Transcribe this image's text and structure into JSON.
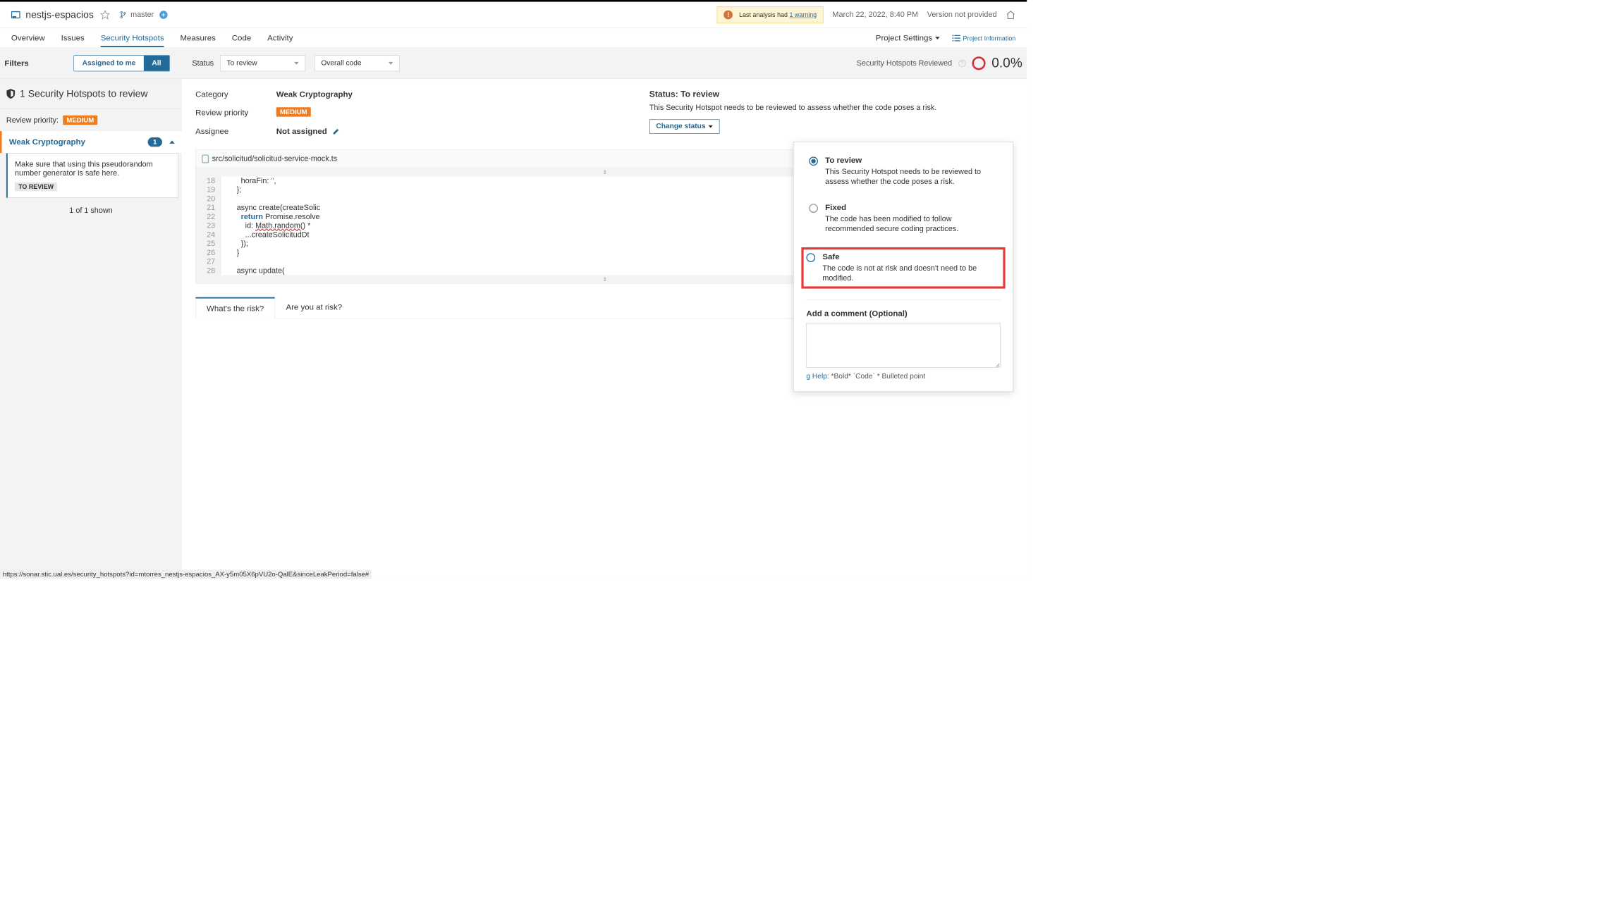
{
  "header": {
    "project_name": "nestjs-espacios",
    "branch": "master",
    "warning_text": "Last analysis had",
    "warning_link": "1 warning",
    "timestamp": "March 22, 2022, 8:40 PM",
    "version": "Version not provided"
  },
  "tabs": {
    "items": [
      "Overview",
      "Issues",
      "Security Hotspots",
      "Measures",
      "Code",
      "Activity"
    ],
    "active": "Security Hotspots",
    "project_settings": "Project Settings",
    "project_information": "Project Information"
  },
  "filters": {
    "label": "Filters",
    "assigned_to_me": "Assigned to me",
    "all": "All",
    "status_label": "Status",
    "status_value": "To review",
    "code_scope": "Overall code",
    "reviewed_label": "Security Hotspots Reviewed",
    "reviewed_percent": "0.0%"
  },
  "sidebar": {
    "title": "1 Security Hotspots to review",
    "priority_label": "Review priority:",
    "priority_value": "MEDIUM",
    "category": "Weak Cryptography",
    "category_count": "1",
    "issue_text": "Make sure that using this pseudorandom number generator is safe here.",
    "issue_status": "TO REVIEW",
    "shown": "1 of 1 shown"
  },
  "detail": {
    "category_label": "Category",
    "category_value": "Weak Cryptography",
    "priority_label": "Review priority",
    "priority_value": "MEDIUM",
    "assignee_label": "Assignee",
    "assignee_value": "Not assigned",
    "status_title": "Status: To review",
    "status_desc": "This Security Hotspot needs to be reviewed to assess whether the code poses a risk.",
    "change_status": "Change status",
    "file_path": "src/solicitud/solicitud-service-mock.ts"
  },
  "code": {
    "lines": [
      {
        "n": "18",
        "t": "      horaFin: '',"
      },
      {
        "n": "19",
        "t": "    };"
      },
      {
        "n": "20",
        "t": ""
      },
      {
        "n": "21",
        "t": "    async create(createSolic"
      },
      {
        "n": "22",
        "t": "      return Promise.resolve"
      },
      {
        "n": "23",
        "t": "        id: Math.random() *"
      },
      {
        "n": "24",
        "t": "        ...createSolicitudDt"
      },
      {
        "n": "25",
        "t": "      });"
      },
      {
        "n": "26",
        "t": "    }"
      },
      {
        "n": "27",
        "t": ""
      },
      {
        "n": "28",
        "t": "    async update("
      }
    ]
  },
  "popup": {
    "options": [
      {
        "title": "To review",
        "desc": "This Security Hotspot needs to be reviewed to assess whether the code poses a risk.",
        "selected": true
      },
      {
        "title": "Fixed",
        "desc": "The code has been modified to follow recommended secure coding practices.",
        "selected": false
      },
      {
        "title": "Safe",
        "desc": "The code is not at risk and doesn't need to be modified.",
        "selected": false,
        "highlighted": true
      }
    ],
    "comment_label": "Add a comment (Optional)",
    "format_help_prefix": "g Help",
    "format_help": ":  *Bold*  `Code`  * Bulleted point"
  },
  "risk_tabs": {
    "whats_risk": "What's the risk?",
    "are_you": "Are you at risk?"
  },
  "footer_url": "https://sonar.stic.ual.es/security_hotspots?id=mtorres_nestjs-espacios_AX-y5m05X6pVU2o-QalE&sinceLeakPeriod=false#"
}
